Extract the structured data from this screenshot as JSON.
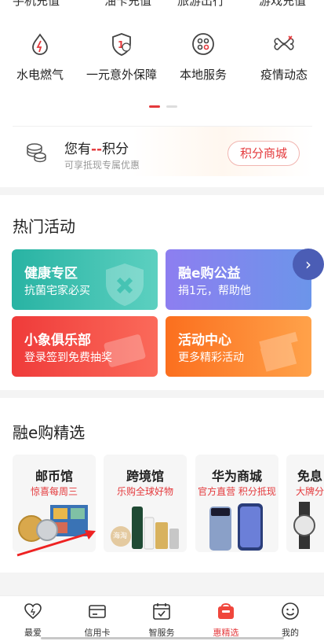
{
  "top_cut_labels": [
    "手机充值",
    "油卡充值",
    "旅游出行",
    "游戏充值"
  ],
  "services": [
    {
      "label": "水电燃气",
      "icon": "utility-drop-icon"
    },
    {
      "label": "一元意外保障",
      "icon": "insurance-shield-icon"
    },
    {
      "label": "本地服务",
      "icon": "local-service-icon"
    },
    {
      "label": "疫情动态",
      "icon": "epidemic-icon"
    }
  ],
  "points": {
    "prefix": "您有",
    "value": "--",
    "suffix": "积分",
    "hint": "可享抵现专属优惠",
    "mall_button": "积分商城"
  },
  "hot": {
    "title": "热门活动",
    "cards": [
      {
        "title": "健康专区",
        "subtitle": "抗菌宅家必买"
      },
      {
        "title": "融e购公益",
        "subtitle": "捐1元，帮助他"
      },
      {
        "title": "小象俱乐部",
        "subtitle": "登录签到免费抽奖"
      },
      {
        "title": "活动中心",
        "subtitle": "更多精彩活动"
      }
    ],
    "next": "›"
  },
  "picks": {
    "title": "融e购精选",
    "items": [
      {
        "name": "邮币馆",
        "sub": "惊喜每周三"
      },
      {
        "name": "跨境馆",
        "sub": "乐购全球好物",
        "tag": "海淘"
      },
      {
        "name": "华为商城",
        "sub": "官方直营 积分抵现"
      },
      {
        "name": "免息",
        "sub": "大牌分"
      }
    ]
  },
  "tabs": [
    {
      "label": "最爱",
      "icon": "heart-icon"
    },
    {
      "label": "信用卡",
      "icon": "credit-card-icon"
    },
    {
      "label": "智服务",
      "icon": "calendar-service-icon"
    },
    {
      "label": "惠精选",
      "icon": "gift-bag-icon"
    },
    {
      "label": "我的",
      "icon": "smiley-profile-icon"
    }
  ],
  "colors": {
    "accent": "#e4393c",
    "teal": "#2fb9a9",
    "purple": "#7b86e8",
    "red": "#f0463c",
    "orange": "#fb7d2a"
  }
}
